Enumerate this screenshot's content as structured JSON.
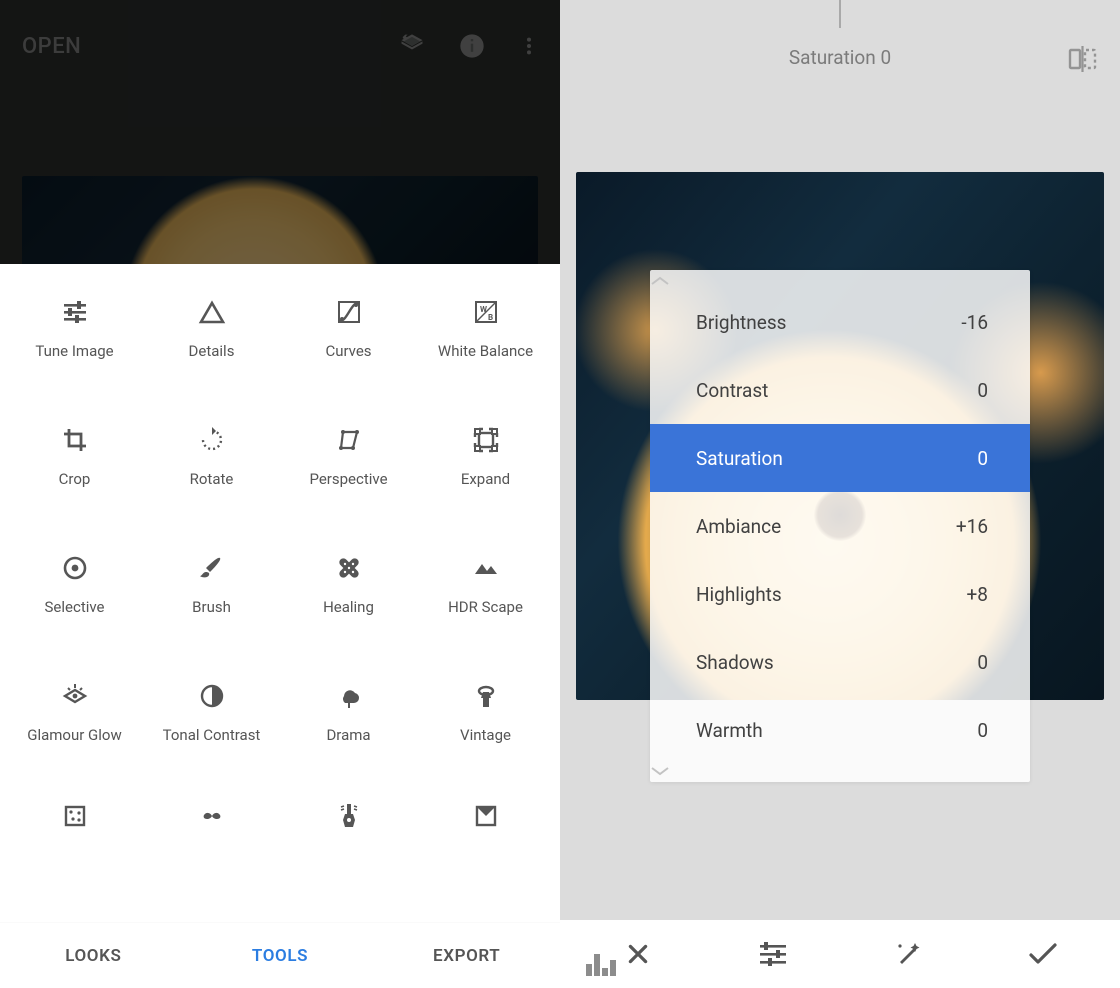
{
  "left": {
    "open_label": "OPEN",
    "tools": [
      {
        "icon": "tune",
        "label": "Tune Image"
      },
      {
        "icon": "details",
        "label": "Details"
      },
      {
        "icon": "curves",
        "label": "Curves"
      },
      {
        "icon": "wb",
        "label": "White Balance"
      },
      {
        "icon": "crop",
        "label": "Crop"
      },
      {
        "icon": "rotate",
        "label": "Rotate"
      },
      {
        "icon": "perspective",
        "label": "Perspective"
      },
      {
        "icon": "expand",
        "label": "Expand"
      },
      {
        "icon": "selective",
        "label": "Selective"
      },
      {
        "icon": "brush",
        "label": "Brush"
      },
      {
        "icon": "healing",
        "label": "Healing"
      },
      {
        "icon": "hdr",
        "label": "HDR Scape"
      },
      {
        "icon": "glow",
        "label": "Glamour Glow"
      },
      {
        "icon": "tonal",
        "label": "Tonal Contrast"
      },
      {
        "icon": "drama",
        "label": "Drama"
      },
      {
        "icon": "vintage",
        "label": "Vintage"
      },
      {
        "icon": "grainy",
        "label": ""
      },
      {
        "icon": "moustache",
        "label": ""
      },
      {
        "icon": "guitar",
        "label": ""
      },
      {
        "icon": "frame",
        "label": ""
      }
    ],
    "tabs": {
      "looks": "LOOKS",
      "tools": "TOOLS",
      "export": "EXPORT",
      "active": "tools"
    }
  },
  "right": {
    "header_param": "Saturation",
    "header_value": "0",
    "adjustments": [
      {
        "name": "Brightness",
        "value": "-16",
        "selected": false
      },
      {
        "name": "Contrast",
        "value": "0",
        "selected": false
      },
      {
        "name": "Saturation",
        "value": "0",
        "selected": true
      },
      {
        "name": "Ambiance",
        "value": "+16",
        "selected": false
      },
      {
        "name": "Highlights",
        "value": "+8",
        "selected": false
      },
      {
        "name": "Shadows",
        "value": "0",
        "selected": false
      },
      {
        "name": "Warmth",
        "value": "0",
        "selected": false
      }
    ]
  },
  "colors": {
    "accent": "#2b7de1",
    "selected_row": "#3a74d8"
  }
}
